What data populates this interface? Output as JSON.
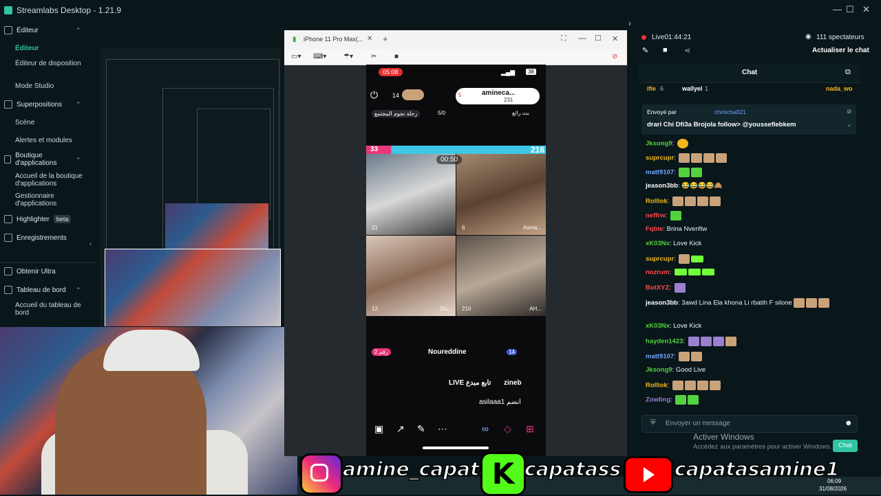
{
  "app": {
    "title": "Streamlabs Desktop - 1.21.9"
  },
  "sidebar": {
    "editor_header": "Éditeur",
    "editor_items": [
      "Éditeur",
      "Éditeur de disposition",
      "Mode Studio"
    ],
    "overlays_header": "Superpositions",
    "overlays_items": [
      "Scène",
      "Alertes et modules"
    ],
    "store_header": "Boutique d'applications",
    "store_items": [
      "Accueil de la boutique d'applications",
      "Gestionnaire d'applications"
    ],
    "highlighter": "Highlighter",
    "highlighter_badge": "beta",
    "recordings": "Enregistrements",
    "ultra": "Obtenir Ultra",
    "dashboard_header": "Tableau de bord",
    "dashboard_items": [
      "Accueil du tableau de bord"
    ]
  },
  "phone_window": {
    "tab_title": "iPhone 11 Pro Max(...",
    "status_time": "05:08",
    "battery": "38",
    "viewer_count": "14",
    "host_name": "amineca...",
    "host_points": "231",
    "gift_count": "5",
    "event_text": "رحلة نجوم المجتمع",
    "progress": "5/0",
    "right_label": "بث رائع",
    "score_left": "33",
    "score_right": "216",
    "battle_timer": "00:50",
    "cell_counts": [
      "21",
      "6",
      "12",
      "210"
    ],
    "cell_names": [
      "Asma...",
      "Ou...",
      "AH..."
    ],
    "rank_label": "رقم 2",
    "comment_user": "Noureddine",
    "comment_level": "14",
    "live_line_user": "zineb",
    "live_line_text": "LIVE تابع مبدع",
    "join_line": "asilaaa1 انضم"
  },
  "chat": {
    "status": "Live01:44:21",
    "spectators": "111 spectateurs",
    "refresh": "Actualiser le chat",
    "tab": "Chat",
    "top_users": [
      {
        "name": "ifie",
        "count": "6"
      },
      {
        "name": "wallyel",
        "count": "1"
      },
      {
        "name": "nada_wo",
        "count": ""
      }
    ],
    "pinned_by_label": "Envoyé par",
    "pinned_by": "chmicha021",
    "pinned_text": "drari Chi Dfi3a Brojola follow> @yousseflebkem",
    "messages": [
      {
        "user": "Jksong9",
        "color": "#53d13e",
        "text": "",
        "emotes": "y"
      },
      {
        "user": "suprcupr",
        "color": "#f4b81f",
        "text": "",
        "emotes": "cccc"
      },
      {
        "user": "matt9107",
        "color": "#6ea8ff",
        "text": "",
        "emotes": "gg"
      },
      {
        "user": "jeason3bb",
        "color": "#ffffff",
        "text": "😂😂😂😂🙈",
        "emotes": ""
      },
      {
        "user": "Rolliok",
        "color": "#f4b81f",
        "text": "",
        "emotes": "cccc"
      },
      {
        "user": "neffrw",
        "color": "#ff4b4b",
        "text": "",
        "emotes": "g"
      },
      {
        "user": "Fqbie",
        "color": "#ff4b4b",
        "text": "Brina Nverifiw",
        "emotes": ""
      },
      {
        "user": "xK03Nx",
        "color": "#53d13e",
        "text": "Love Kick",
        "emotes": ""
      },
      {
        "user": "suprcupr",
        "color": "#f4b81f",
        "text": "",
        "emotes": "cb"
      },
      {
        "user": "nozrum",
        "color": "#ff4b4b",
        "text": "",
        "emotes": "bbb"
      },
      {
        "user": "BotXYZ",
        "color": "#ff4b4b",
        "text": "",
        "emotes": "p"
      },
      {
        "user": "jeason3bb",
        "color": "#ffffff",
        "text": "3awd Lina Ela khona Li rbatih F silone",
        "emotes": "ccc"
      },
      {
        "user": "xK03Nx",
        "color": "#53d13e",
        "text": "Love Kick",
        "emotes": ""
      },
      {
        "user": "hayden1423",
        "color": "#53d13e",
        "text": "",
        "emotes": "pppc"
      },
      {
        "user": "matt9107",
        "color": "#6ea8ff",
        "text": "",
        "emotes": "cc"
      },
      {
        "user": "Jksong9",
        "color": "#53d13e",
        "text": "Good Live",
        "emotes": ""
      },
      {
        "user": "Rolliok",
        "color": "#f4b81f",
        "text": "",
        "emotes": "cccc"
      },
      {
        "user": "Zowling",
        "color": "#9b7fd0",
        "text": "",
        "emotes": "gg"
      }
    ],
    "input_placeholder": "Envoyer un message",
    "send_button": "Chat"
  },
  "watermark": {
    "line1": "Activer Windows",
    "line2": "Accédez aux paramètres pour activer Windows."
  },
  "socials": {
    "instagram": "amine_capatas",
    "kick": "capatass",
    "youtube": "capatasamine1"
  },
  "taskbar": {
    "time": "06:09",
    "date": "31/08/2026"
  },
  "colors": {
    "accent": "#31c3a2",
    "bg": "#09161a",
    "kick": "#53fc18",
    "youtube": "#ff0000"
  }
}
